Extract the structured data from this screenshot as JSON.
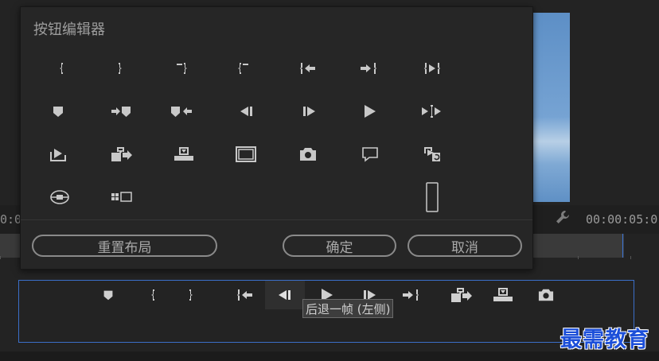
{
  "background": {
    "timecode_left": "0:0",
    "timecode_right": "00:00:05:0"
  },
  "dialog": {
    "title": "按钮编辑器",
    "buttons": [
      {
        "name": "mark-in-icon"
      },
      {
        "name": "mark-out-icon"
      },
      {
        "name": "mark-clip-in-icon"
      },
      {
        "name": "mark-clip-out-icon"
      },
      {
        "name": "go-to-in-icon"
      },
      {
        "name": "go-to-out-icon"
      },
      {
        "name": "play-in-to-out-icon"
      },
      {
        "name": "add-marker-icon"
      },
      {
        "name": "go-to-next-marker-icon"
      },
      {
        "name": "go-to-previous-marker-icon"
      },
      {
        "name": "step-back-icon"
      },
      {
        "name": "step-forward-icon"
      },
      {
        "name": "play-stop-icon"
      },
      {
        "name": "play-around-icon"
      },
      {
        "name": "lift-icon"
      },
      {
        "name": "insert-icon"
      },
      {
        "name": "overwrite-icon"
      },
      {
        "name": "safe-margins-icon"
      },
      {
        "name": "export-frame-icon"
      },
      {
        "name": "comment-icon"
      },
      {
        "name": "loop-icon"
      },
      {
        "name": "vr-video-icon"
      },
      {
        "name": "multi-camera-icon"
      },
      {
        "name": "spacer-icon"
      }
    ],
    "reset_label": "重置布局",
    "ok_label": "确定",
    "cancel_label": "取消"
  },
  "transport": {
    "tooltip": "后退一帧 (左侧)"
  },
  "watermark": "最需教育"
}
